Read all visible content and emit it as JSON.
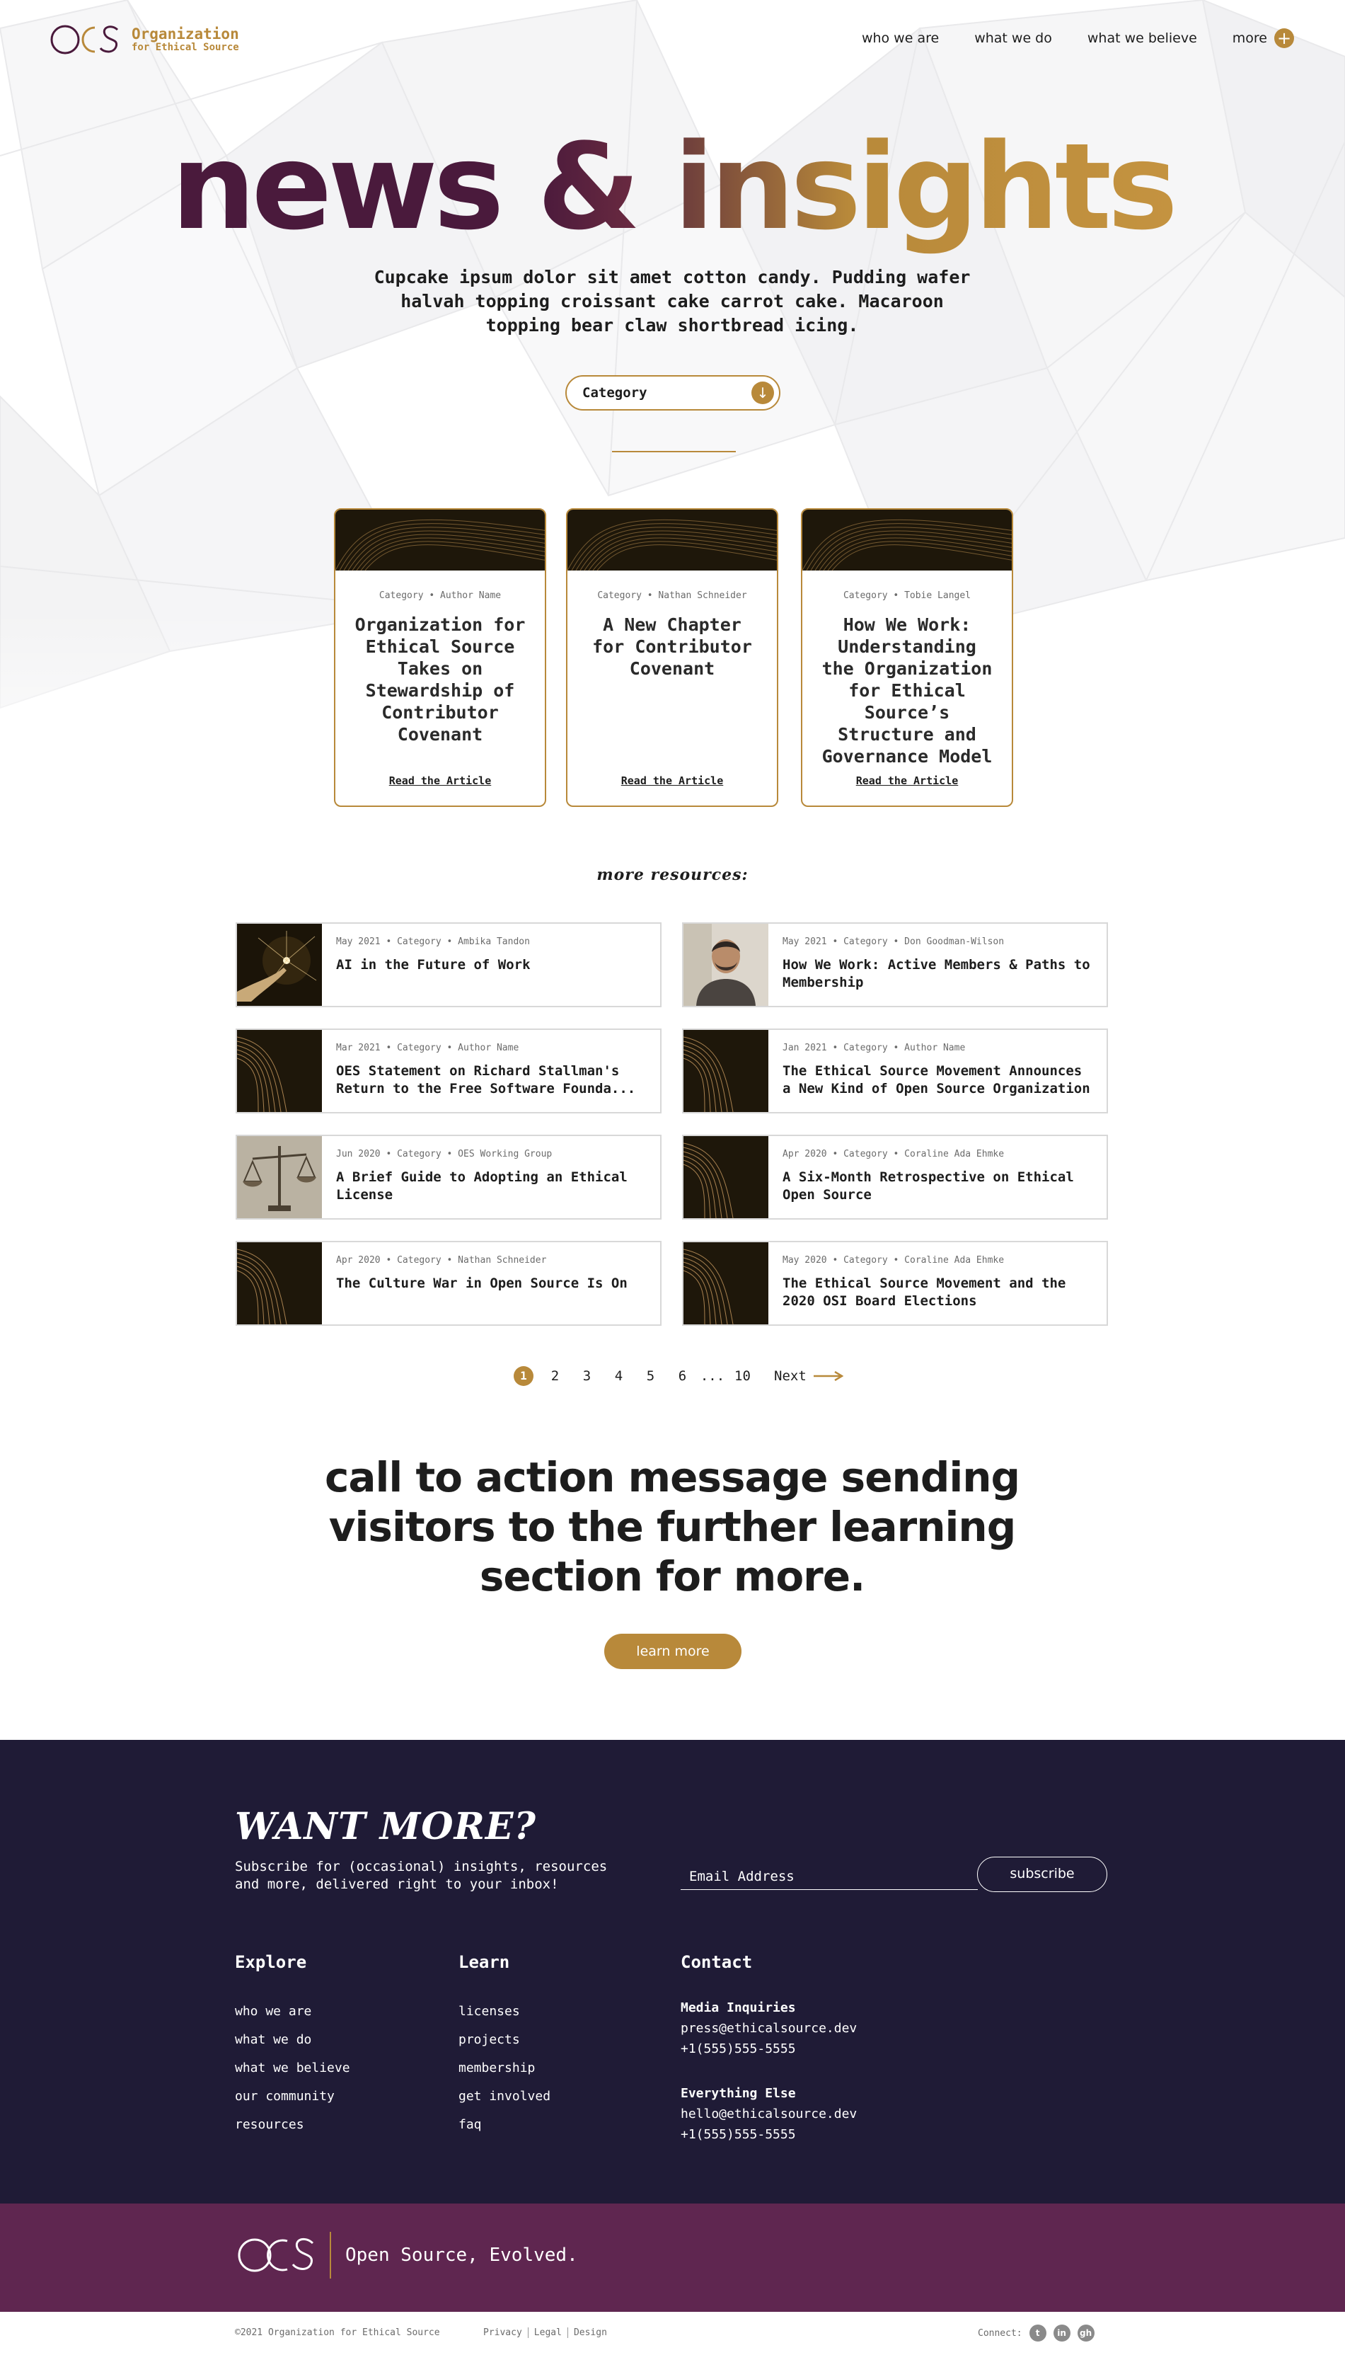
{
  "header": {
    "logo_name": "Organization",
    "logo_sub": "for Ethical Source",
    "nav": [
      "who we are",
      "what we do",
      "what we believe"
    ],
    "more_label": "more"
  },
  "hero": {
    "title_part1": "news",
    "title_part2": "&",
    "title_part3": "insights",
    "description": "Cupcake ipsum dolor sit amet cotton candy. Pudding wafer halvah topping croissant cake carrot cake. Macaroon topping bear claw shortbread icing.",
    "category_label": "Category"
  },
  "featured": [
    {
      "meta": "Category • Author Name",
      "title": "Organization for Ethical Source Takes on Stewardship of Contributor Covenant",
      "link": "Read the Article"
    },
    {
      "meta": "Category • Nathan Schneider",
      "title": "A New Chapter for Contributor Covenant",
      "link": "Read the Article"
    },
    {
      "meta": "Category • Tobie Langel",
      "title": "How We Work: Understanding the Organization for Ethical Source’s Structure and Governance Model",
      "link": "Read the Article"
    }
  ],
  "more_resources_title": "more resources:",
  "resources": [
    {
      "meta": "May 2021 • Category • Ambika Tandon",
      "title": "AI in the Future of Work",
      "thumb": "robot-hand"
    },
    {
      "meta": "May 2021 • Category • Don Goodman-Wilson",
      "title": "How We Work: Active Members & Paths to Membership",
      "thumb": "portrait"
    },
    {
      "meta": "Mar 2021 • Category • Author Name",
      "title": "OES Statement on Richard Stallman's Return to the Free Software Founda...",
      "thumb": "gold-lines"
    },
    {
      "meta": "Jan 2021 • Category • Author Name",
      "title": "The Ethical Source Movement Announces a New Kind of Open Source Organization",
      "thumb": "gold-lines"
    },
    {
      "meta": "Jun 2020 • Category • OES Working Group",
      "title": "A Brief Guide to Adopting an Ethical License",
      "thumb": "scales"
    },
    {
      "meta": "Apr 2020 • Category • Coraline Ada Ehmke",
      "title": "A Six-Month Retrospective on Ethical Open Source",
      "thumb": "gold-lines"
    },
    {
      "meta": "Apr 2020 • Category • Nathan Schneider",
      "title": "The Culture War in Open Source Is On",
      "thumb": "gold-lines"
    },
    {
      "meta": "May 2020 • Category • Coraline Ada Ehmke",
      "title": "The Ethical Source Movement and the 2020 OSI Board Elections",
      "thumb": "gold-lines"
    }
  ],
  "pagination": {
    "current": "1",
    "pages": [
      "2",
      "3",
      "4",
      "5",
      "6"
    ],
    "dots": "...",
    "last": "10",
    "next": "Next"
  },
  "cta": {
    "text": "call to action message sending visitors to the further learning section for more.",
    "button": "learn more"
  },
  "footer": {
    "want_more": "WANT MORE?",
    "subscribe_text": "Subscribe for (occasional) insights, resources and more, delivered right to your inbox!",
    "email_placeholder": "Email Address",
    "subscribe_button": "subscribe",
    "explore_title": "Explore",
    "explore_links": [
      "who we are",
      "what we do",
      "what we believe",
      "our community",
      "resources"
    ],
    "learn_title": "Learn",
    "learn_links": [
      "licenses",
      "projects",
      "membership",
      "get involved",
      "faq"
    ],
    "contact_title": "Contact",
    "media_label": "Media Inquiries",
    "media_email": "press@ethicalsource.dev",
    "media_phone": "+1(555)555-5555",
    "else_label": "Everything Else",
    "else_email": "hello@ethicalsource.dev",
    "else_phone": "+1(555)555-5555"
  },
  "band": {
    "tagline": "Open Source, Evolved."
  },
  "bottom": {
    "copyright": "©2021 Organization for Ethical Source",
    "legal": [
      "Privacy",
      "Legal",
      "Design"
    ],
    "connect_label": "Connect:"
  },
  "colors": {
    "gold": "#b8893a",
    "plum": "#4a1a3c",
    "navy": "#1f1b36",
    "purple_band": "#5f2650"
  }
}
